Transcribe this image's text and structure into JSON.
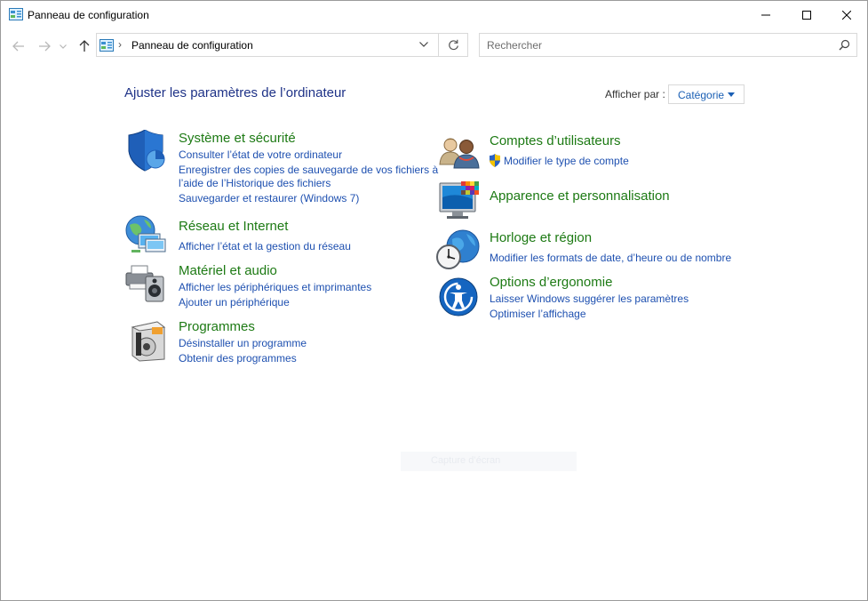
{
  "window": {
    "title": "Panneau de configuration",
    "controls": [
      "minimize",
      "maximize",
      "close"
    ]
  },
  "navbar": {
    "breadcrumb": "Panneau de configuration",
    "search_placeholder": "Rechercher"
  },
  "main": {
    "heading": "Ajuster les paramètres de l’ordinateur",
    "view_by_label": "Afficher par :",
    "view_by_value": "Catégorie",
    "hidden_text": "Capture d’écran"
  },
  "categories": {
    "system": {
      "title": "Système et sécurité",
      "links": [
        "Consulter l’état de votre ordinateur",
        "Enregistrer des copies de sauvegarde de vos fichiers à",
        "l’aide de l’Historique des fichiers",
        "Sauvegarder et restaurer (Windows 7)"
      ]
    },
    "network": {
      "title": "Réseau et Internet",
      "links": [
        "Afficher l’état et la gestion du réseau"
      ]
    },
    "hardware": {
      "title": "Matériel et audio",
      "links": [
        "Afficher les périphériques et imprimantes",
        "Ajouter un périphérique"
      ]
    },
    "programs": {
      "title": "Programmes",
      "links": [
        "Désinstaller un programme",
        "Obtenir des programmes"
      ]
    },
    "accounts": {
      "title": "Comptes d’utilisateurs",
      "links": [
        "Modifier le type de compte"
      ]
    },
    "appearance": {
      "title": "Apparence et personnalisation",
      "links": []
    },
    "clock": {
      "title": "Horloge et région",
      "links": [
        "Modifier les formats de date, d’heure ou de nombre"
      ]
    },
    "ease": {
      "title": "Options d’ergonomie",
      "links": [
        "Laisser Windows suggérer les paramètres",
        "Optimiser l’affichage"
      ]
    }
  },
  "colors": {
    "heading": "#1e3287",
    "category_title": "#1d7a14",
    "link": "#1e50b0"
  }
}
